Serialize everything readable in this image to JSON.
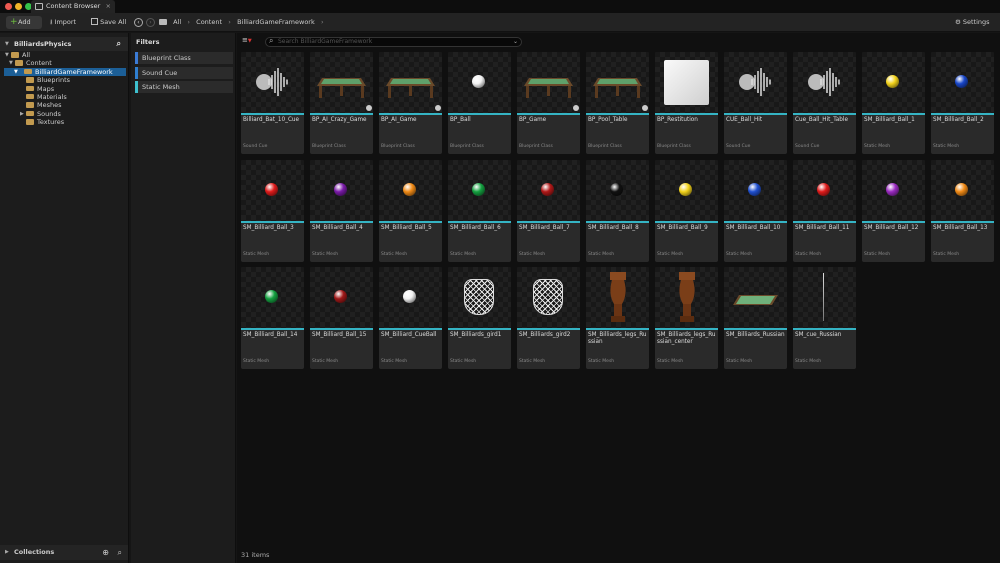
{
  "window": {
    "tab_title": "Content Browser",
    "close_glyph": "×"
  },
  "toolbar": {
    "add_label": "Add",
    "import_label": "Import",
    "save_all_label": "Save All",
    "settings_label": "Settings"
  },
  "breadcrumb": [
    "All",
    "Content",
    "BilliardGameFramework"
  ],
  "left_panel": {
    "title": "BilliardsPhysics",
    "tree": [
      "All",
      "Content",
      "BilliardGameFramework",
      "Blueprints",
      "Maps",
      "Materials",
      "Meshes",
      "Sounds",
      "Textures"
    ],
    "collections_label": "Collections"
  },
  "filters": {
    "title": "Filters",
    "items": [
      {
        "label": "Blueprint Class",
        "color": "#3b7bd6"
      },
      {
        "label": "Sound Cue",
        "color": "#2f7fd0"
      },
      {
        "label": "Static Mesh",
        "color": "#3ec1cf"
      }
    ]
  },
  "search": {
    "placeholder": "Search BilliardGameFramework"
  },
  "assets": [
    {
      "name": "Billiard_Bat_10_Cue",
      "type": "Sound Cue",
      "thumb": "sound"
    },
    {
      "name": "BP_AI_Crazy_Game",
      "type": "Blueprint Class",
      "thumb": "table"
    },
    {
      "name": "BP_AI_Game",
      "type": "Blueprint Class",
      "thumb": "table"
    },
    {
      "name": "BP_Ball",
      "type": "Blueprint Class",
      "thumb": "ball",
      "color": "#f2f2f2"
    },
    {
      "name": "BP_Game",
      "type": "Blueprint Class",
      "thumb": "table"
    },
    {
      "name": "BP_Pool_Table",
      "type": "Blueprint Class",
      "thumb": "table"
    },
    {
      "name": "BP_Restitution",
      "type": "Blueprint Class",
      "thumb": "cube"
    },
    {
      "name": "CUE_Ball_Hit",
      "type": "Sound Cue",
      "thumb": "sound"
    },
    {
      "name": "Cue_Ball_Hit_Table",
      "type": "Sound Cue",
      "thumb": "sound"
    },
    {
      "name": "SM_Billiard_Ball_1",
      "type": "Static Mesh",
      "thumb": "ball",
      "color": "#f2d21b"
    },
    {
      "name": "SM_Billiard_Ball_2",
      "type": "Static Mesh",
      "thumb": "ball",
      "color": "#1846c9"
    },
    {
      "name": "SM_Billiard_Ball_3",
      "type": "Static Mesh",
      "thumb": "ball",
      "color": "#e01b1b"
    },
    {
      "name": "SM_Billiard_Ball_4",
      "type": "Static Mesh",
      "thumb": "ball",
      "color": "#7a1aa8"
    },
    {
      "name": "SM_Billiard_Ball_5",
      "type": "Static Mesh",
      "thumb": "ball",
      "color": "#f08a16"
    },
    {
      "name": "SM_Billiard_Ball_6",
      "type": "Static Mesh",
      "thumb": "ball",
      "color": "#14a040"
    },
    {
      "name": "SM_Billiard_Ball_7",
      "type": "Static Mesh",
      "thumb": "ball",
      "color": "#b01818"
    },
    {
      "name": "SM_Billiard_Ball_8",
      "type": "Static Mesh",
      "thumb": "ball",
      "color": "#111111"
    },
    {
      "name": "SM_Billiard_Ball_9",
      "type": "Static Mesh",
      "thumb": "ball",
      "color": "#f2d21b"
    },
    {
      "name": "SM_Billiard_Ball_10",
      "type": "Static Mesh",
      "thumb": "ball",
      "color": "#2050d0"
    },
    {
      "name": "SM_Billiard_Ball_11",
      "type": "Static Mesh",
      "thumb": "ball",
      "color": "#e01b1b"
    },
    {
      "name": "SM_Billiard_Ball_12",
      "type": "Static Mesh",
      "thumb": "ball",
      "color": "#9a2ac0"
    },
    {
      "name": "SM_Billiard_Ball_13",
      "type": "Static Mesh",
      "thumb": "ball",
      "color": "#f08a16"
    },
    {
      "name": "SM_Billiard_Ball_14",
      "type": "Static Mesh",
      "thumb": "ball",
      "color": "#14a040"
    },
    {
      "name": "SM_Billiard_Ball_15",
      "type": "Static Mesh",
      "thumb": "ball",
      "color": "#a01818"
    },
    {
      "name": "SM_Billiard_CueBall",
      "type": "Static Mesh",
      "thumb": "ball",
      "color": "#f2f2f2"
    },
    {
      "name": "SM_Billiards_gird1",
      "type": "Static Mesh",
      "thumb": "net"
    },
    {
      "name": "SM_Billiards_gird2",
      "type": "Static Mesh",
      "thumb": "net"
    },
    {
      "name": "SM_Billiards_legs_Russian",
      "type": "Static Mesh",
      "thumb": "leg"
    },
    {
      "name": "SM_Billiards_legs_Russian_center",
      "type": "Static Mesh",
      "thumb": "leg"
    },
    {
      "name": "SM_Billiards_Russian",
      "type": "Static Mesh",
      "thumb": "tabletop"
    },
    {
      "name": "SM_cue_Russian",
      "type": "Static Mesh",
      "thumb": "cue"
    }
  ],
  "status": {
    "item_count": "31 items"
  }
}
